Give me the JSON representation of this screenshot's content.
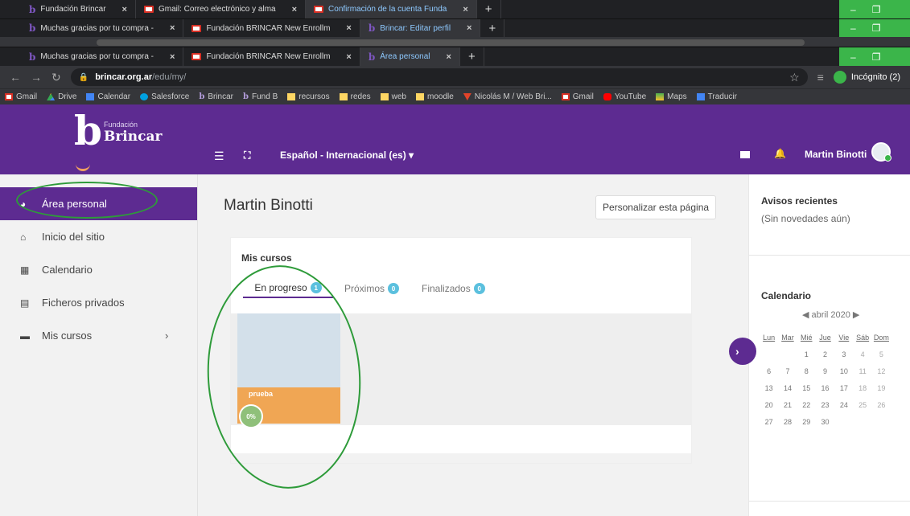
{
  "browser": {
    "strip1_tabs": [
      {
        "icon": "b",
        "title": "Fundación Brincar",
        "active": false
      },
      {
        "icon": "gmail",
        "title": "Gmail: Correo electrónico y alma",
        "active": false
      },
      {
        "icon": "gmail",
        "title": "Confirmación de la cuenta Funda",
        "active": true
      }
    ],
    "strip2_tabs": [
      {
        "icon": "b",
        "title": "Muchas gracias por tu compra -",
        "active": false
      },
      {
        "icon": "gmail",
        "title": "Fundación BRINCAR New Enrollm",
        "active": false
      },
      {
        "icon": "b",
        "title": "Brincar: Editar perfil",
        "active": true
      }
    ],
    "strip4_tabs": [
      {
        "icon": "b",
        "title": "Muchas gracias por tu compra -",
        "active": false
      },
      {
        "icon": "gmail",
        "title": "Fundación BRINCAR New Enrollm",
        "active": false
      },
      {
        "icon": "b",
        "title": "Área personal",
        "active": true
      }
    ],
    "close_glyph": "×",
    "new_tab_glyph": "+",
    "window_controls": {
      "minimize": "–",
      "restore": "❐"
    },
    "url_host": "brincar.org.ar",
    "url_path": "/edu/my/",
    "incognito_label": "Incógnito (2)",
    "bookmarks": [
      {
        "icon": "gmail",
        "label": "Gmail"
      },
      {
        "icon": "drive",
        "label": "Drive"
      },
      {
        "icon": "cal",
        "label": "Calendar"
      },
      {
        "icon": "sf",
        "label": "Salesforce"
      },
      {
        "icon": "b",
        "label": "Brincar"
      },
      {
        "icon": "b",
        "label": "Fund B"
      },
      {
        "icon": "folder",
        "label": "recursos"
      },
      {
        "icon": "folder",
        "label": "redes"
      },
      {
        "icon": "folder",
        "label": "web"
      },
      {
        "icon": "folder",
        "label": "moodle"
      },
      {
        "icon": "fox",
        "label": "Nicolás M / Web Bri..."
      },
      {
        "icon": "gmail",
        "label": "Gmail"
      },
      {
        "icon": "yt",
        "label": "YouTube"
      },
      {
        "icon": "maps",
        "label": "Maps"
      },
      {
        "icon": "tr",
        "label": "Traducir"
      }
    ]
  },
  "topnav": {
    "brand_small": "Fundación",
    "brand_name": "Brincar",
    "brand_letter": "b",
    "language": "Español - Internacional (es) ▾",
    "user_name": "Martin Binotti"
  },
  "sidebar": {
    "items": [
      {
        "label": "Área personal",
        "icon": "dashboard-icon",
        "active": true
      },
      {
        "label": "Inicio del sitio",
        "icon": "home-icon",
        "active": false
      },
      {
        "label": "Calendario",
        "icon": "calendar-icon",
        "active": false
      },
      {
        "label": "Ficheros privados",
        "icon": "file-icon",
        "active": false
      },
      {
        "label": "Mis cursos",
        "icon": "graduation-icon",
        "active": false,
        "chevron": "›"
      }
    ]
  },
  "main": {
    "title": "Martin Binotti",
    "customize_label": "Personalizar esta página",
    "courses_title": "Mis cursos",
    "tabs": [
      {
        "label": "En progreso",
        "count": "1",
        "active": true
      },
      {
        "label": "Próximos",
        "count": "0",
        "active": false
      },
      {
        "label": "Finalizados",
        "count": "0",
        "active": false
      }
    ],
    "course": {
      "name": "prueba",
      "progress": "0%"
    }
  },
  "blocks": {
    "recent_title": "Avisos recientes",
    "recent_text": "(Sin novedades aún)",
    "calendar_title": "Calendario",
    "calendar_month": "◀ abril 2020 ▶",
    "weekdays": [
      "Lun",
      "Mar",
      "Mié",
      "Jue",
      "Vie",
      "Sáb",
      "Dom"
    ],
    "weeks": [
      [
        "",
        "",
        "1",
        "2",
        "3",
        "4",
        "5"
      ],
      [
        "6",
        "7",
        "8",
        "9",
        "10",
        "11",
        "12"
      ],
      [
        "13",
        "14",
        "15",
        "16",
        "17",
        "18",
        "19"
      ],
      [
        "20",
        "21",
        "22",
        "23",
        "24",
        "25",
        "26"
      ],
      [
        "27",
        "28",
        "29",
        "30",
        "",
        "",
        ""
      ]
    ]
  },
  "colors": {
    "brand_purple": "#5d2b91",
    "annotation_green": "#2e9b3a",
    "course_orange": "#f0a654",
    "badge_blue": "#5bc0de"
  }
}
